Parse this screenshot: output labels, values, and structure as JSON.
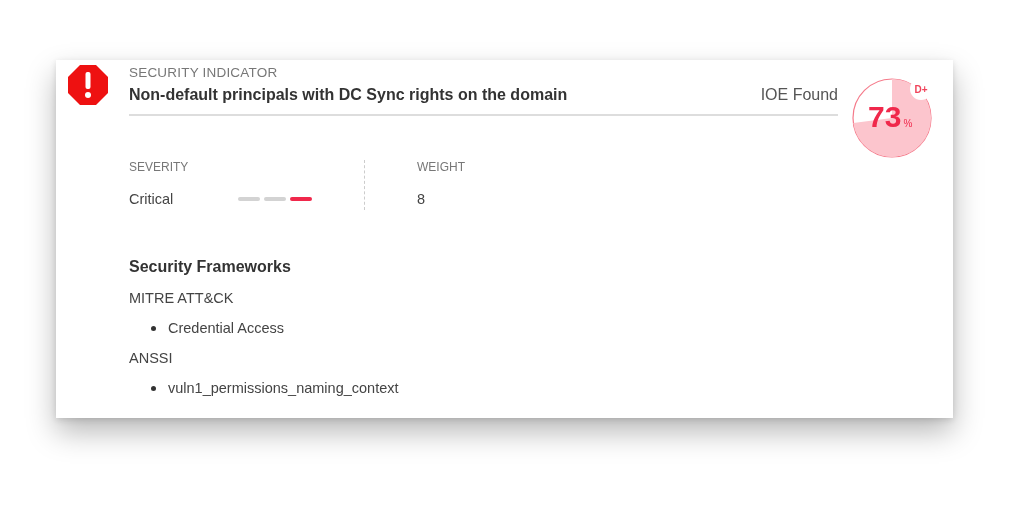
{
  "indicator": {
    "label": "SECURITY INDICATOR",
    "title": "Non-default principals with DC Sync rights on the domain",
    "status": "IOE Found"
  },
  "score": {
    "value": "73",
    "unit": "%",
    "grade": "D+"
  },
  "severity": {
    "label": "SEVERITY",
    "value": "Critical",
    "segments": [
      {
        "on": false
      },
      {
        "on": false
      },
      {
        "on": true
      }
    ]
  },
  "weight": {
    "label": "WEIGHT",
    "value": "8"
  },
  "frameworks": {
    "title": "Security Frameworks",
    "groups": [
      {
        "name": "MITRE ATT&CK",
        "items": [
          "Credential Access"
        ]
      },
      {
        "name": "ANSSI",
        "items": [
          "vuln1_permissions_naming_context"
        ]
      }
    ]
  }
}
